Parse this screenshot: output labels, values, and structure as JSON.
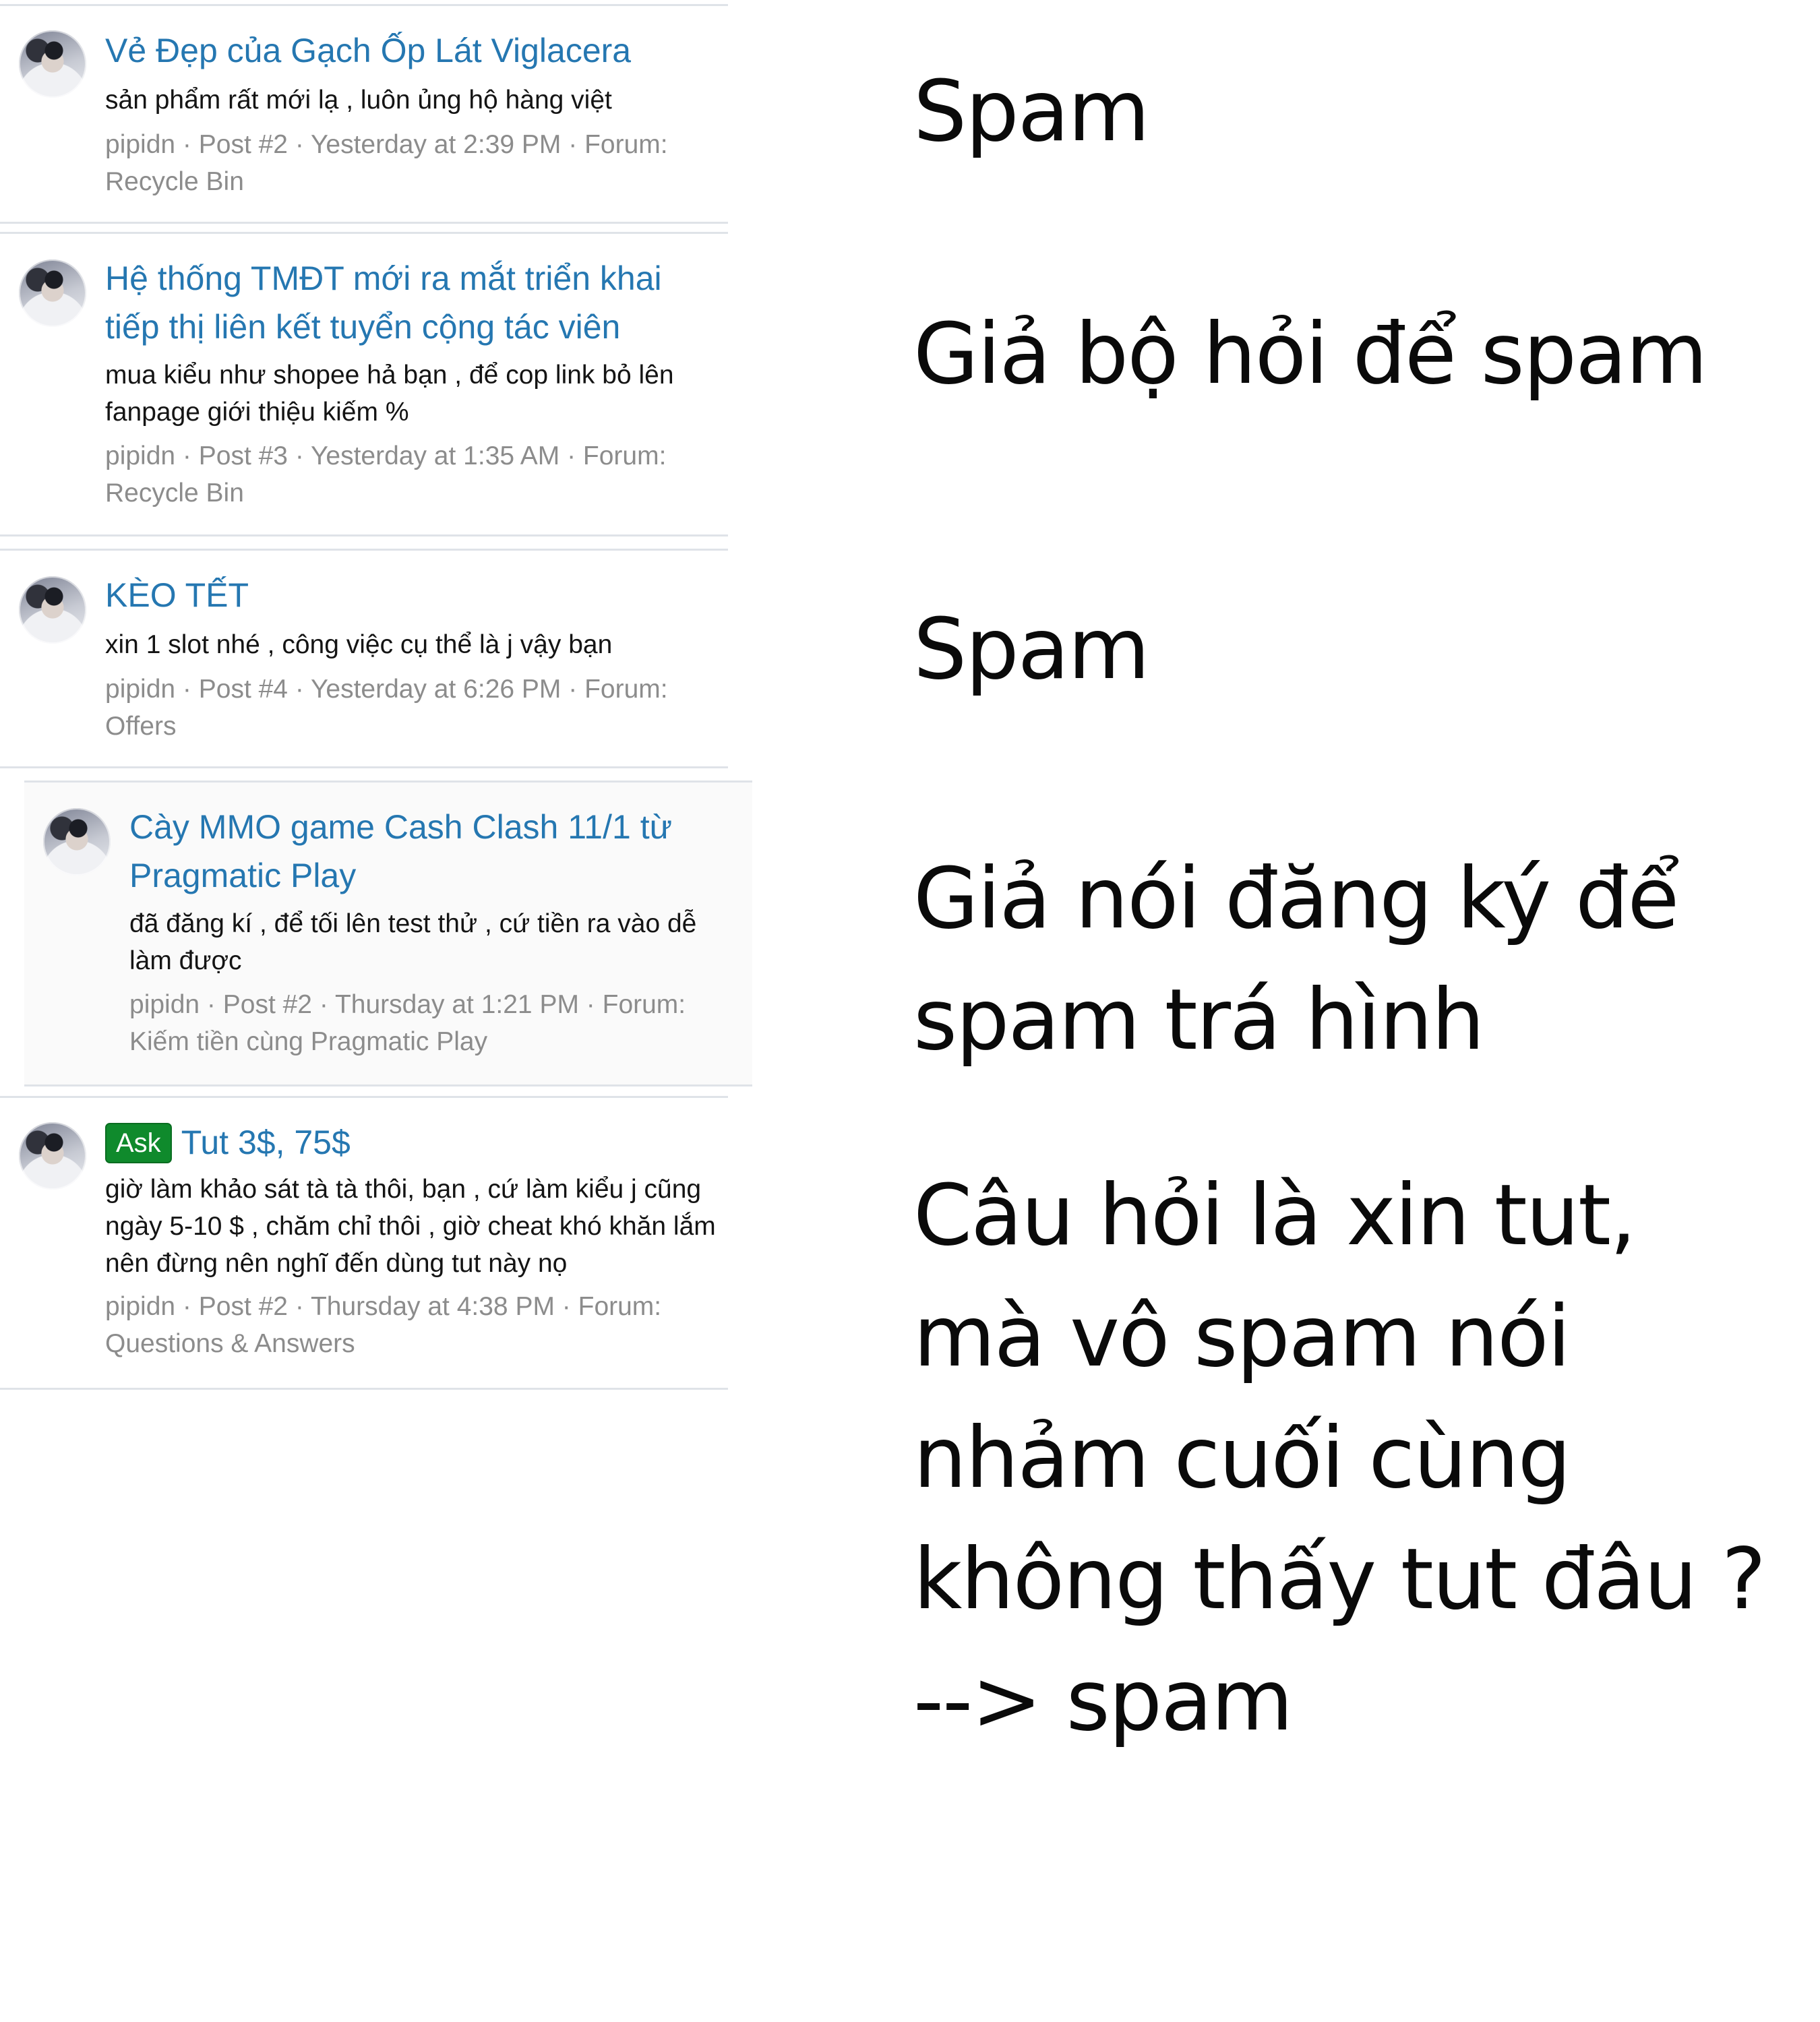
{
  "posts": [
    {
      "title": "Vẻ Đẹp của Gạch Ốp Lát Viglacera",
      "prefix": "",
      "snippet": "sản phẩm rất mới lạ , luôn ủng hộ hàng việt",
      "meta": "pipidn · Post #2 · Yesterday at 2:39 PM · Forum: Recycle Bin"
    },
    {
      "title": "Hệ thống TMĐT mới ra mắt triển khai tiếp thị liên kết tuyển cộng tác viên",
      "prefix": "",
      "snippet": "mua kiểu như shopee hả bạn , để cop link bỏ lên fanpage giới thiệu kiếm %",
      "meta": "pipidn · Post #3 · Yesterday at 1:35 AM · Forum: Recycle Bin"
    },
    {
      "title": "KÈO TẾT",
      "prefix": "",
      "snippet": "xin 1 slot nhé , công việc cụ thể là j vậy bạn",
      "meta": "pipidn · Post #4 · Yesterday at 6:26 PM · Forum: Offers"
    },
    {
      "title": "Cày MMO game Cash Clash 11/1 từ Pragmatic Play",
      "prefix": "",
      "snippet": "đã đăng kí , để tối lên test thử , cứ tiền ra vào dễ làm được",
      "meta": "pipidn · Post #2 · Thursday at 1:21 PM · Forum: Kiếm tiền cùng Pragmatic Play"
    },
    {
      "title": "Tut 3$, 75$",
      "prefix": "Ask",
      "snippet": "giờ làm khảo sát tà tà thôi, bạn , cứ làm kiểu j cũng ngày 5-10 $ , chăm chỉ thôi , giờ cheat khó khăn lắm nên đừng nên nghĩ đến dùng tut này nọ",
      "meta": "pipidn · Post #2 · Thursday at 4:38 PM · Forum: Questions & Answers"
    }
  ],
  "notes": [
    "Spam",
    "Giả bộ hỏi để spam",
    "Spam",
    "Giả nói đăng ký để spam trá hình",
    "Câu hỏi là xin tut, mà vô spam nói nhảm cuối cùng không thấy tut đâu ? --> spam"
  ],
  "colors": {
    "title": "#2577b1",
    "prefix_badge": "#0f8a2c",
    "meta": "#8c8c8c"
  }
}
